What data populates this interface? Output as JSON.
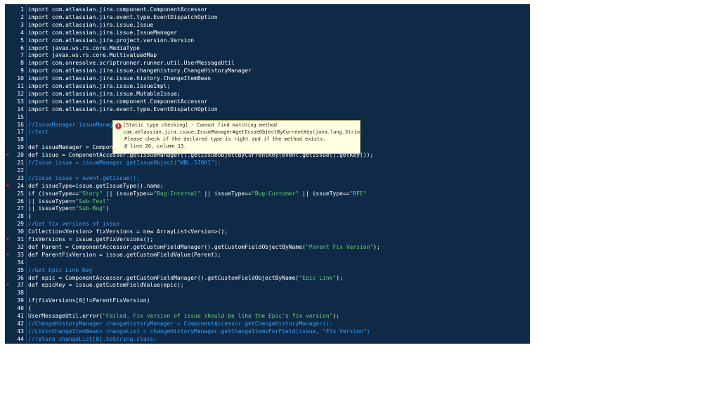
{
  "editor": {
    "lines": [
      {
        "n": "1",
        "text": "import com.atlassian.jira.component.ComponentAccessor",
        "cls": "",
        "err": false
      },
      {
        "n": "2",
        "text": "import com.atlassian.jira.event.type.EventDispatchOption",
        "cls": "",
        "err": false
      },
      {
        "n": "3",
        "text": "import com.atlassian.jira.issue.Issue",
        "cls": "",
        "err": false
      },
      {
        "n": "4",
        "text": "import com.atlassian.jira.issue.IssueManager",
        "cls": "",
        "err": false
      },
      {
        "n": "5",
        "text": "import com.atlassian.jira.project.version.Version",
        "cls": "",
        "err": false
      },
      {
        "n": "6",
        "text": "import javax.ws.rs.core.MediaType",
        "cls": "",
        "err": false
      },
      {
        "n": "7",
        "text": "import javax.ws.rs.core.MultivaluedMap",
        "cls": "",
        "err": false
      },
      {
        "n": "8",
        "text": "import com.onresolve.scriptrunner.runner.util.UserMessageUtil",
        "cls": "",
        "err": false
      },
      {
        "n": "9",
        "text": "import com.atlassian.jira.issue.changehistory.ChangeHistoryManager",
        "cls": "",
        "err": false
      },
      {
        "n": "10",
        "text": "import com.atlassian.jira.issue.history.ChangeItemBean",
        "cls": "",
        "err": false
      },
      {
        "n": "11",
        "text": "import com.atlassian.jira.issue.IssueImpl;",
        "cls": "",
        "err": false
      },
      {
        "n": "12",
        "text": "import com.atlassian.jira.issue.MutableIssue;",
        "cls": "",
        "err": false
      },
      {
        "n": "13",
        "text": "import com.atlassian.jira.component.ComponentAccessor",
        "cls": "",
        "err": false
      },
      {
        "n": "14",
        "text": "import com.atlassian.jira.event.type.EventDispatchOption",
        "cls": "",
        "err": false
      },
      {
        "n": "15",
        "text": "",
        "cls": "",
        "err": false
      },
      {
        "n": "16",
        "text": "//IssueManager issueManager",
        "cls": "cm",
        "err": false
      },
      {
        "n": "17",
        "text": "//test",
        "cls": "cm",
        "err": false
      },
      {
        "n": "18",
        "text": "",
        "cls": "",
        "err": false
      },
      {
        "n": "19",
        "text": "def issueManager = Componen",
        "cls": "",
        "err": false
      },
      {
        "n": "20",
        "text": "def issue = ComponentAccessor.getIssueManager().getIssueObjectByCurrentKey(event.getIssue().getKey());",
        "cls": "",
        "err": true
      },
      {
        "n": "21",
        "text": "//Issue issue = issueManager.getIssueObject(\"WBL-57061\");",
        "cls": "cm",
        "err": false
      },
      {
        "n": "22",
        "text": "",
        "cls": "",
        "err": false
      },
      {
        "n": "23",
        "text": "//Issue issue = event.getIssue();",
        "cls": "cm",
        "err": false
      },
      {
        "n": "24",
        "text": "def issueType=issue.getIssueType().name;",
        "cls": "",
        "err": true
      },
      {
        "n": "25",
        "text": "if (issueType==\"Story\" || issueType==\"Bug-Internal\" || issueType==\"Bug-Customer\" || issueType==\"RFE\"",
        "cls": "",
        "err": false
      },
      {
        "n": "26",
        "text": "|| issueType==\"Sub-Test\"",
        "cls": "",
        "err": false
      },
      {
        "n": "27",
        "text": "|| issueType==\"Sub-Bug\")",
        "cls": "",
        "err": false
      },
      {
        "n": "28",
        "text": "{",
        "cls": "",
        "err": false
      },
      {
        "n": "29",
        "text": "//Get fix versions of issue",
        "cls": "cm",
        "err": false
      },
      {
        "n": "30",
        "text": "Collection<Version> fixVersions = new ArrayList<Version>();",
        "cls": "",
        "err": false
      },
      {
        "n": "31",
        "text": "fixVersions = issue.getFixVersions();",
        "cls": "",
        "err": true
      },
      {
        "n": "32",
        "text": "def Parent = ComponentAccessor.getCustomFieldManager().getCustomFieldObjectByName(\"Parent Fix Version\");",
        "cls": "",
        "err": false
      },
      {
        "n": "33",
        "text": "def ParentFixVersion = issue.getCustomFieldValue(Parent);",
        "cls": "",
        "err": true
      },
      {
        "n": "34",
        "text": "",
        "cls": "",
        "err": false
      },
      {
        "n": "35",
        "text": "//Get Epic Link Key",
        "cls": "cm",
        "err": false
      },
      {
        "n": "36",
        "text": "def epic = ComponentAccessor.getCustomFieldManager().getCustomFieldObjectByName(\"Epic Link\");",
        "cls": "",
        "err": false
      },
      {
        "n": "37",
        "text": "def epicKey = issue.getCustomFieldValue(epic);",
        "cls": "",
        "err": true
      },
      {
        "n": "38",
        "text": "",
        "cls": "",
        "err": false
      },
      {
        "n": "39",
        "text": "if(fixVersions[0]!=ParentFixVersion)",
        "cls": "",
        "err": false
      },
      {
        "n": "40",
        "text": "{",
        "cls": "",
        "err": false
      },
      {
        "n": "41",
        "text": "UserMessageUtil.error(\"Failed. Fix version of issue should be like the Epic's fix version\");",
        "cls": "",
        "err": false
      },
      {
        "n": "42",
        "text": "//ChangeHistoryManager changeHistoryManager = ComponentAccessor.getChangeHistoryManager();",
        "cls": "cm",
        "err": false
      },
      {
        "n": "43",
        "text": "//List<ChangeItemBean> changeList = changeHistoryManager.getChangeItemsForField(issue, \"Fix Version\")",
        "cls": "cm",
        "err": false
      },
      {
        "n": "44",
        "text": "//return changeList[0].toString.class;",
        "cls": "cm",
        "err": false
      }
    ]
  },
  "tooltip": {
    "line1": "[Static type checking] - Cannot find matching method",
    "line2": "com.atlassian.jira.issue.IssueManager#getIssueObjectByCurrentKey(java.lang.Strin",
    "line3": "Please check if the declared type is right and if the method exists.",
    "line4": "@ line 20, column 13.",
    "icon": "error-icon"
  },
  "colors": {
    "editor_bg": "#0e2a47",
    "comment": "#3a9ef8",
    "string": "#6fd16f",
    "error": "#ff4747",
    "tooltip_bg": "#ffffe1"
  }
}
